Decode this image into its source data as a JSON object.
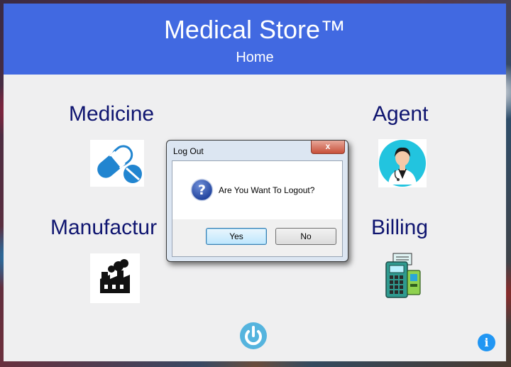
{
  "header": {
    "title": "Medical Store™",
    "subtitle": "Home"
  },
  "modules": {
    "medicine": {
      "label": "Medicine",
      "icon": "pills-icon"
    },
    "agent": {
      "label": "Agent",
      "icon": "doctor-icon"
    },
    "manufacturer": {
      "label": "Manufactur",
      "icon": "factory-icon"
    },
    "billing": {
      "label": "Billing",
      "icon": "billing-machine-icon"
    }
  },
  "footer": {
    "power_icon": "power-icon",
    "info_icon": "info-icon"
  },
  "dialog": {
    "title": "Log Out",
    "close_glyph": "x",
    "message": "Are You Want To Logout?",
    "yes_label": "Yes",
    "no_label": "No",
    "icon": "question-icon"
  },
  "colors": {
    "header_bg": "#4169e1",
    "label_color": "#0f1570",
    "icon_blue": "#2185d0"
  }
}
